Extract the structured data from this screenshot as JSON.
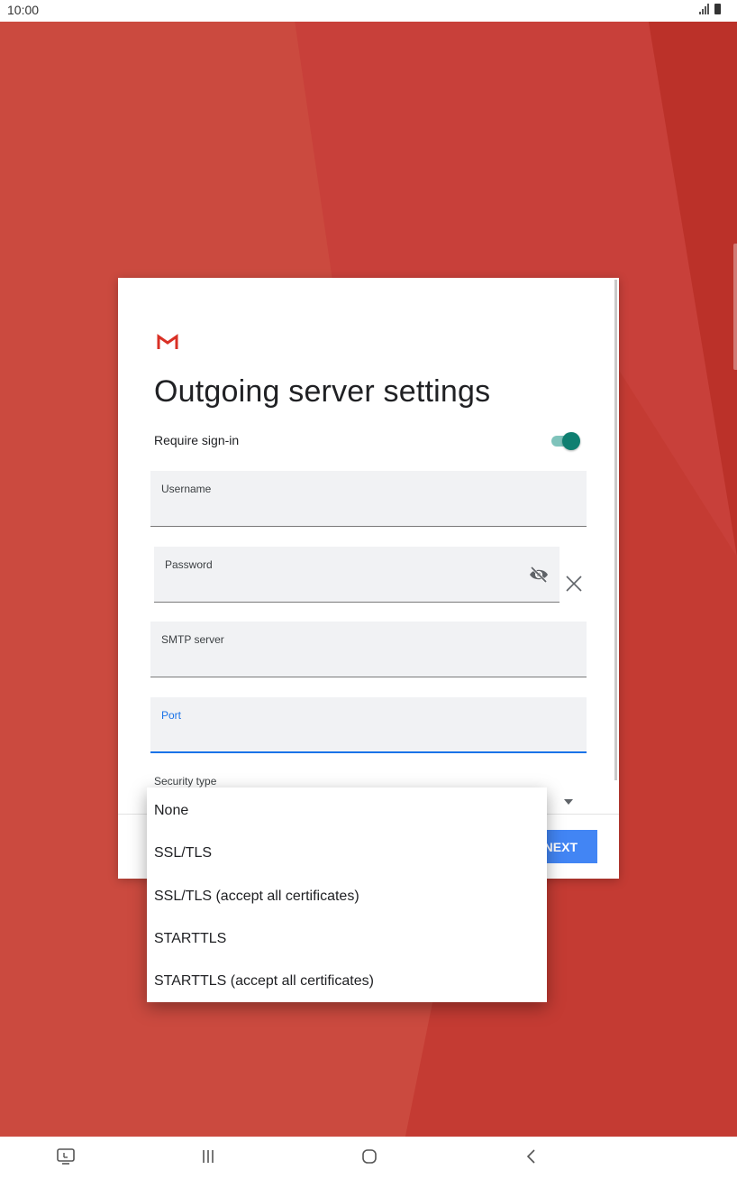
{
  "status_bar": {
    "time": "10:00"
  },
  "app": {
    "logo_icon": "gmail-m-icon",
    "accent_color": "#4285f4",
    "toggle_color": "#0f7f71"
  },
  "dialog": {
    "title": "Outgoing server settings",
    "require_signin_label": "Require sign-in",
    "require_signin_enabled": true,
    "fields": {
      "username": {
        "label": "Username",
        "value": ""
      },
      "password": {
        "label": "Password",
        "value": ""
      },
      "smtp_server": {
        "label": "SMTP server",
        "value": ""
      },
      "port": {
        "label": "Port",
        "value": ""
      }
    },
    "security_type_label": "Security type",
    "next_label": "NEXT"
  },
  "dropdown": {
    "options": [
      "None",
      "SSL/TLS",
      "SSL/TLS (accept all certificates)",
      "STARTTLS",
      "STARTTLS (accept all certificates)"
    ]
  },
  "nav_bar": {
    "icons": [
      "screenshot-icon",
      "recent-apps-icon",
      "home-icon",
      "back-icon"
    ]
  }
}
